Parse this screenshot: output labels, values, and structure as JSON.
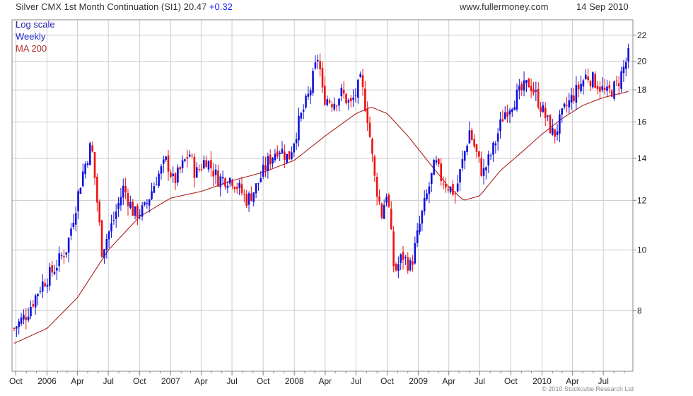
{
  "header": {
    "title": "Silver CMX 1st Month Continuation (SI1)",
    "last": "20.47",
    "change": "+0.32",
    "site": "www.fullermoney.com",
    "date": "14 Sep 2010"
  },
  "legend": {
    "scale": "Log scale",
    "period": "Weekly",
    "ma": "MA 200"
  },
  "copyright": "© 2010 Stockcube Research Ltd",
  "colors": {
    "up": "#1010dd",
    "down": "#ee1010",
    "ma": "#aa2222",
    "grid": "#cccccc"
  },
  "chart_data": {
    "type": "candlestick",
    "y_scale": "log",
    "ylim": [
      7.0,
      22.8
    ],
    "y_ticks": [
      8,
      10,
      12,
      14,
      16,
      18,
      20,
      22
    ],
    "x_ticks": [
      "Oct",
      "2006",
      "Apr",
      "Jul",
      "Oct",
      "2007",
      "Apr",
      "Jul",
      "Oct",
      "2008",
      "Apr",
      "Jul",
      "Oct",
      "2009",
      "Apr",
      "Jul",
      "Oct",
      "2010",
      "Apr",
      "Jul"
    ],
    "x_start": "2005-09-26",
    "x_end": "2010-09-20",
    "grid": true,
    "anchors": [
      [
        "2005-09-26",
        7.5
      ],
      [
        "2005-11-01",
        7.9
      ],
      [
        "2005-12-15",
        8.8
      ],
      [
        "2006-01-20",
        9.3
      ],
      [
        "2006-03-01",
        10.1
      ],
      [
        "2006-04-15",
        13.2
      ],
      [
        "2006-05-12",
        14.8
      ],
      [
        "2006-06-12",
        10.0
      ],
      [
        "2006-07-15",
        11.1
      ],
      [
        "2006-08-15",
        12.6
      ],
      [
        "2006-09-15",
        11.4
      ],
      [
        "2006-10-15",
        11.6
      ],
      [
        "2006-11-20",
        13.0
      ],
      [
        "2006-12-20",
        13.9
      ],
      [
        "2007-01-10",
        12.8
      ],
      [
        "2007-02-25",
        14.3
      ],
      [
        "2007-03-15",
        13.2
      ],
      [
        "2007-04-15",
        14.0
      ],
      [
        "2007-05-20",
        13.0
      ],
      [
        "2007-07-01",
        13.0
      ],
      [
        "2007-08-15",
        12.0
      ],
      [
        "2007-09-10",
        12.6
      ],
      [
        "2007-10-15",
        13.8
      ],
      [
        "2007-11-15",
        14.6
      ],
      [
        "2007-12-15",
        14.0
      ],
      [
        "2008-01-15",
        16.0
      ],
      [
        "2008-02-15",
        17.8
      ],
      [
        "2008-03-12",
        20.5
      ],
      [
        "2008-03-25",
        17.6
      ],
      [
        "2008-04-25",
        17.2
      ],
      [
        "2008-05-20",
        17.8
      ],
      [
        "2008-06-15",
        17.0
      ],
      [
        "2008-07-15",
        18.6
      ],
      [
        "2008-08-05",
        16.2
      ],
      [
        "2008-08-25",
        13.0
      ],
      [
        "2008-09-15",
        11.4
      ],
      [
        "2008-10-01",
        12.5
      ],
      [
        "2008-10-22",
        9.2
      ],
      [
        "2008-11-15",
        9.8
      ],
      [
        "2008-12-10",
        9.4
      ],
      [
        "2009-01-10",
        11.3
      ],
      [
        "2009-02-20",
        13.8
      ],
      [
        "2009-03-10",
        13.0
      ],
      [
        "2009-04-20",
        12.3
      ],
      [
        "2009-06-01",
        15.5
      ],
      [
        "2009-07-10",
        13.2
      ],
      [
        "2009-08-10",
        14.5
      ],
      [
        "2009-09-10",
        16.5
      ],
      [
        "2009-10-15",
        17.5
      ],
      [
        "2009-11-25",
        18.5
      ],
      [
        "2009-12-15",
        17.6
      ],
      [
        "2010-02-05",
        15.2
      ],
      [
        "2010-03-10",
        16.8
      ],
      [
        "2010-04-15",
        18.0
      ],
      [
        "2010-05-12",
        19.0
      ],
      [
        "2010-06-10",
        18.5
      ],
      [
        "2010-07-10",
        17.7
      ],
      [
        "2010-08-10",
        18.3
      ],
      [
        "2010-09-14",
        20.47
      ]
    ],
    "ma200": [
      [
        "2005-09-26",
        7.1
      ],
      [
        "2006-01-01",
        7.5
      ],
      [
        "2006-04-01",
        8.4
      ],
      [
        "2006-07-01",
        10.0
      ],
      [
        "2006-10-01",
        11.3
      ],
      [
        "2007-01-01",
        12.1
      ],
      [
        "2007-04-01",
        12.4
      ],
      [
        "2007-07-01",
        12.9
      ],
      [
        "2007-10-01",
        13.3
      ],
      [
        "2008-01-01",
        13.9
      ],
      [
        "2008-04-01",
        15.2
      ],
      [
        "2008-07-01",
        16.5
      ],
      [
        "2008-08-15",
        16.9
      ],
      [
        "2008-10-01",
        16.5
      ],
      [
        "2008-12-01",
        15.2
      ],
      [
        "2009-02-01",
        13.8
      ],
      [
        "2009-04-01",
        12.6
      ],
      [
        "2009-05-15",
        12.0
      ],
      [
        "2009-07-01",
        12.2
      ],
      [
        "2009-09-01",
        13.4
      ],
      [
        "2009-11-01",
        14.3
      ],
      [
        "2010-01-01",
        15.3
      ],
      [
        "2010-03-01",
        16.2
      ],
      [
        "2010-05-01",
        17.0
      ],
      [
        "2010-07-01",
        17.5
      ],
      [
        "2010-09-14",
        17.9
      ]
    ]
  }
}
